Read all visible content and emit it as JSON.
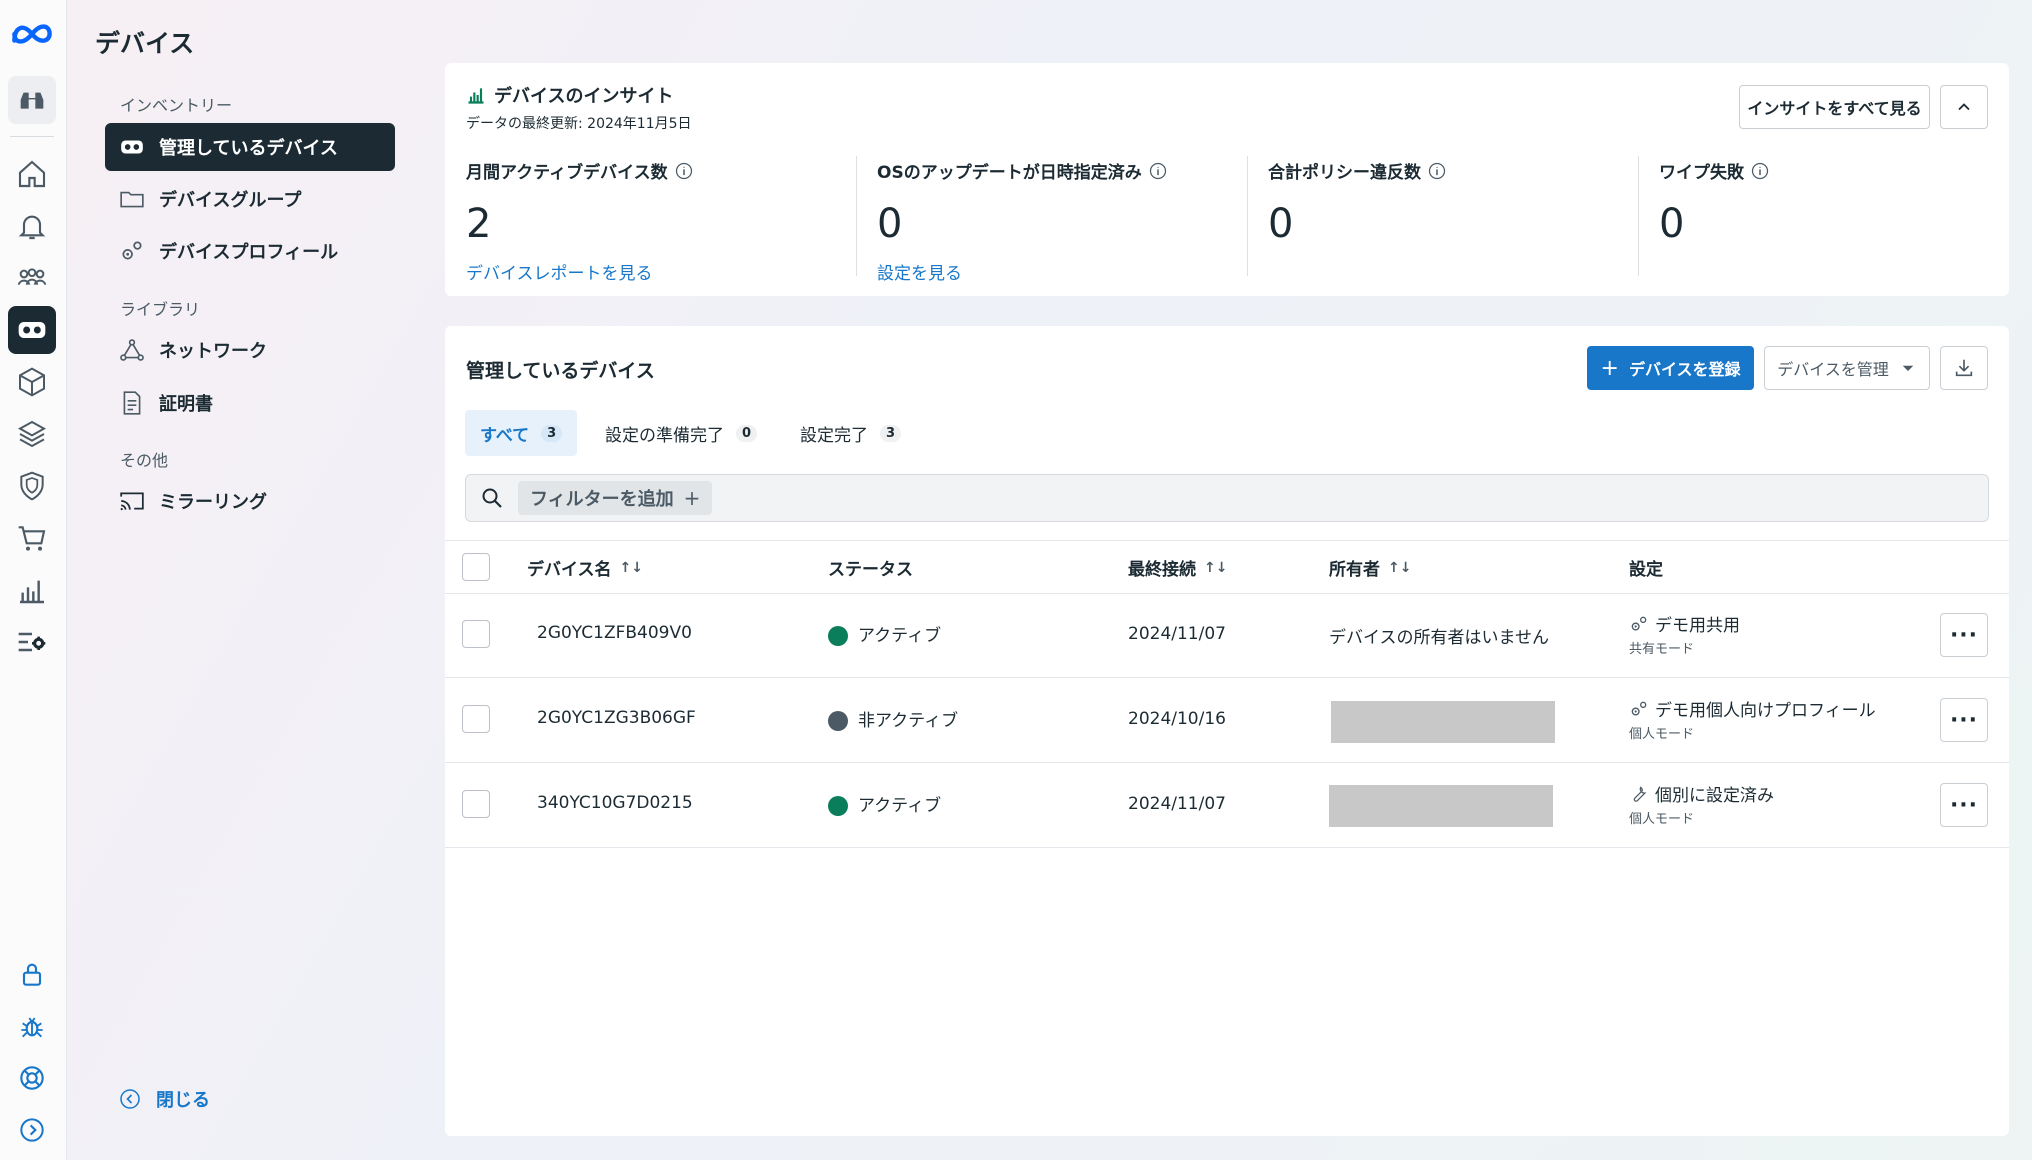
{
  "page": {
    "title": "デバイス"
  },
  "colors": {
    "accent": "#1877c9",
    "nav_active": "#1c2b33",
    "status_active": "#0a7e5a",
    "status_inactive": "#4b5a65"
  },
  "rail": {
    "icons": [
      "meta-logo-icon",
      "binoculars-icon",
      "home-icon",
      "bell-icon",
      "users-icon",
      "vr-headset-icon",
      "cube-icon",
      "layers-icon",
      "shield-icon",
      "cart-icon",
      "bar-chart-icon",
      "settings-list-icon",
      "lock-icon",
      "bug-icon",
      "help-lifebuoy-icon",
      "expand-icon"
    ]
  },
  "sidebar": {
    "sections": [
      {
        "label": "インベントリー",
        "items": [
          {
            "label": "管理しているデバイス",
            "icon": "vr-headset-icon",
            "active": true
          },
          {
            "label": "デバイスグループ",
            "icon": "folder-icon"
          },
          {
            "label": "デバイスプロフィール",
            "icon": "gears-icon"
          }
        ]
      },
      {
        "label": "ライブラリ",
        "items": [
          {
            "label": "ネットワーク",
            "icon": "network-icon"
          },
          {
            "label": "証明書",
            "icon": "document-icon"
          }
        ]
      },
      {
        "label": "その他",
        "items": [
          {
            "label": "ミラーリング",
            "icon": "cast-icon"
          }
        ]
      }
    ],
    "close_label": "閉じる"
  },
  "insights": {
    "title": "デバイスのインサイト",
    "last_updated": "データの最終更新: 2024年11月5日",
    "see_all_label": "インサイトをすべて見る",
    "metrics": [
      {
        "label": "月間アクティブデバイス数",
        "value": "2",
        "link": "デバイスレポートを見る"
      },
      {
        "label": "OSのアップデートが日時指定済み",
        "value": "0",
        "link": "設定を見る"
      },
      {
        "label": "合計ポリシー違反数",
        "value": "0",
        "link": ""
      },
      {
        "label": "ワイプ失敗",
        "value": "0",
        "link": ""
      }
    ]
  },
  "devices": {
    "title": "管理しているデバイス",
    "register_label": "デバイスを登録",
    "manage_label": "デバイスを管理",
    "tabs": [
      {
        "label": "すべて",
        "count": "3",
        "active": true
      },
      {
        "label": "設定の準備完了",
        "count": "0"
      },
      {
        "label": "設定完了",
        "count": "3"
      }
    ],
    "filter_label": "フィルターを追加",
    "columns": [
      "デバイス名",
      "ステータス",
      "最終接続",
      "所有者",
      "設定"
    ],
    "rows": [
      {
        "name": "2G0YC1ZFB409V0",
        "status": "アクティブ",
        "status_color": "#0a7e5a",
        "last_connected": "2024/11/07",
        "owner": "デバイスの所有者はいません",
        "setting": "デモ用共用",
        "mode": "共有モード",
        "setting_icon": "gears-icon"
      },
      {
        "name": "2G0YC1ZG3B06GF",
        "status": "非アクティブ",
        "status_color": "#4b5a65",
        "last_connected": "2024/10/16",
        "owner": "",
        "setting": "デモ用個人向けプロフィール",
        "mode": "個人モード",
        "setting_icon": "gears-icon"
      },
      {
        "name": "340YC10G7D0215",
        "status": "アクティブ",
        "status_color": "#0a7e5a",
        "last_connected": "2024/11/07",
        "owner": "",
        "setting": "個別に設定済み",
        "mode": "個人モード",
        "setting_icon": "wrench-icon"
      }
    ]
  }
}
